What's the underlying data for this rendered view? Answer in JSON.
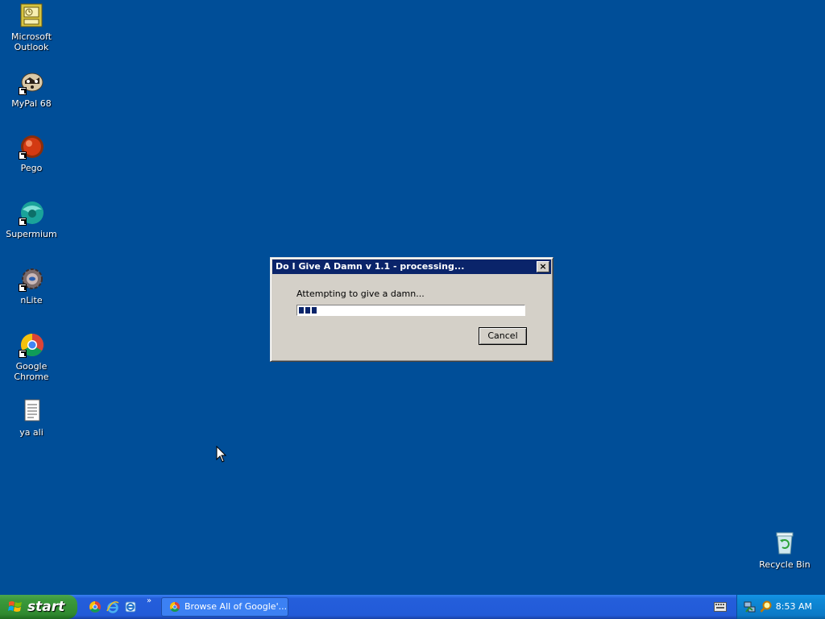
{
  "desktop": {
    "icons": [
      {
        "label": "Microsoft\nOutlook",
        "icon": "outlook-icon"
      },
      {
        "label": "MyPal 68",
        "icon": "mypal-icon"
      },
      {
        "label": "Pego",
        "icon": "pego-icon"
      },
      {
        "label": "Supermium",
        "icon": "supermium-icon"
      },
      {
        "label": "nLite",
        "icon": "nlite-icon"
      },
      {
        "label": "Google Chrome",
        "icon": "chrome-icon"
      },
      {
        "label": "ya ali",
        "icon": "text-file-icon"
      },
      {
        "label": "Recycle Bin",
        "icon": "recycle-bin-icon"
      }
    ]
  },
  "dialog": {
    "title": "Do I Give A Damn v 1.1 - processing...",
    "close_label": "×",
    "status_text": "Attempting to give a damn...",
    "progress_percent": 8,
    "cancel_label": "Cancel"
  },
  "taskbar": {
    "start_label": "start",
    "quicklaunch": [
      "chrome-icon",
      "ie-icon",
      "ie-alt-icon"
    ],
    "more_label": "»",
    "task_button_label": "Browse All of Google'...",
    "clock": "8:53 AM"
  },
  "colors": {
    "desktop": "#004e98",
    "titlebar": "#0a246a",
    "dialog_face": "#d4d0c8",
    "taskbar_blue": "#245edb",
    "start_green": "#3c9a3c"
  }
}
